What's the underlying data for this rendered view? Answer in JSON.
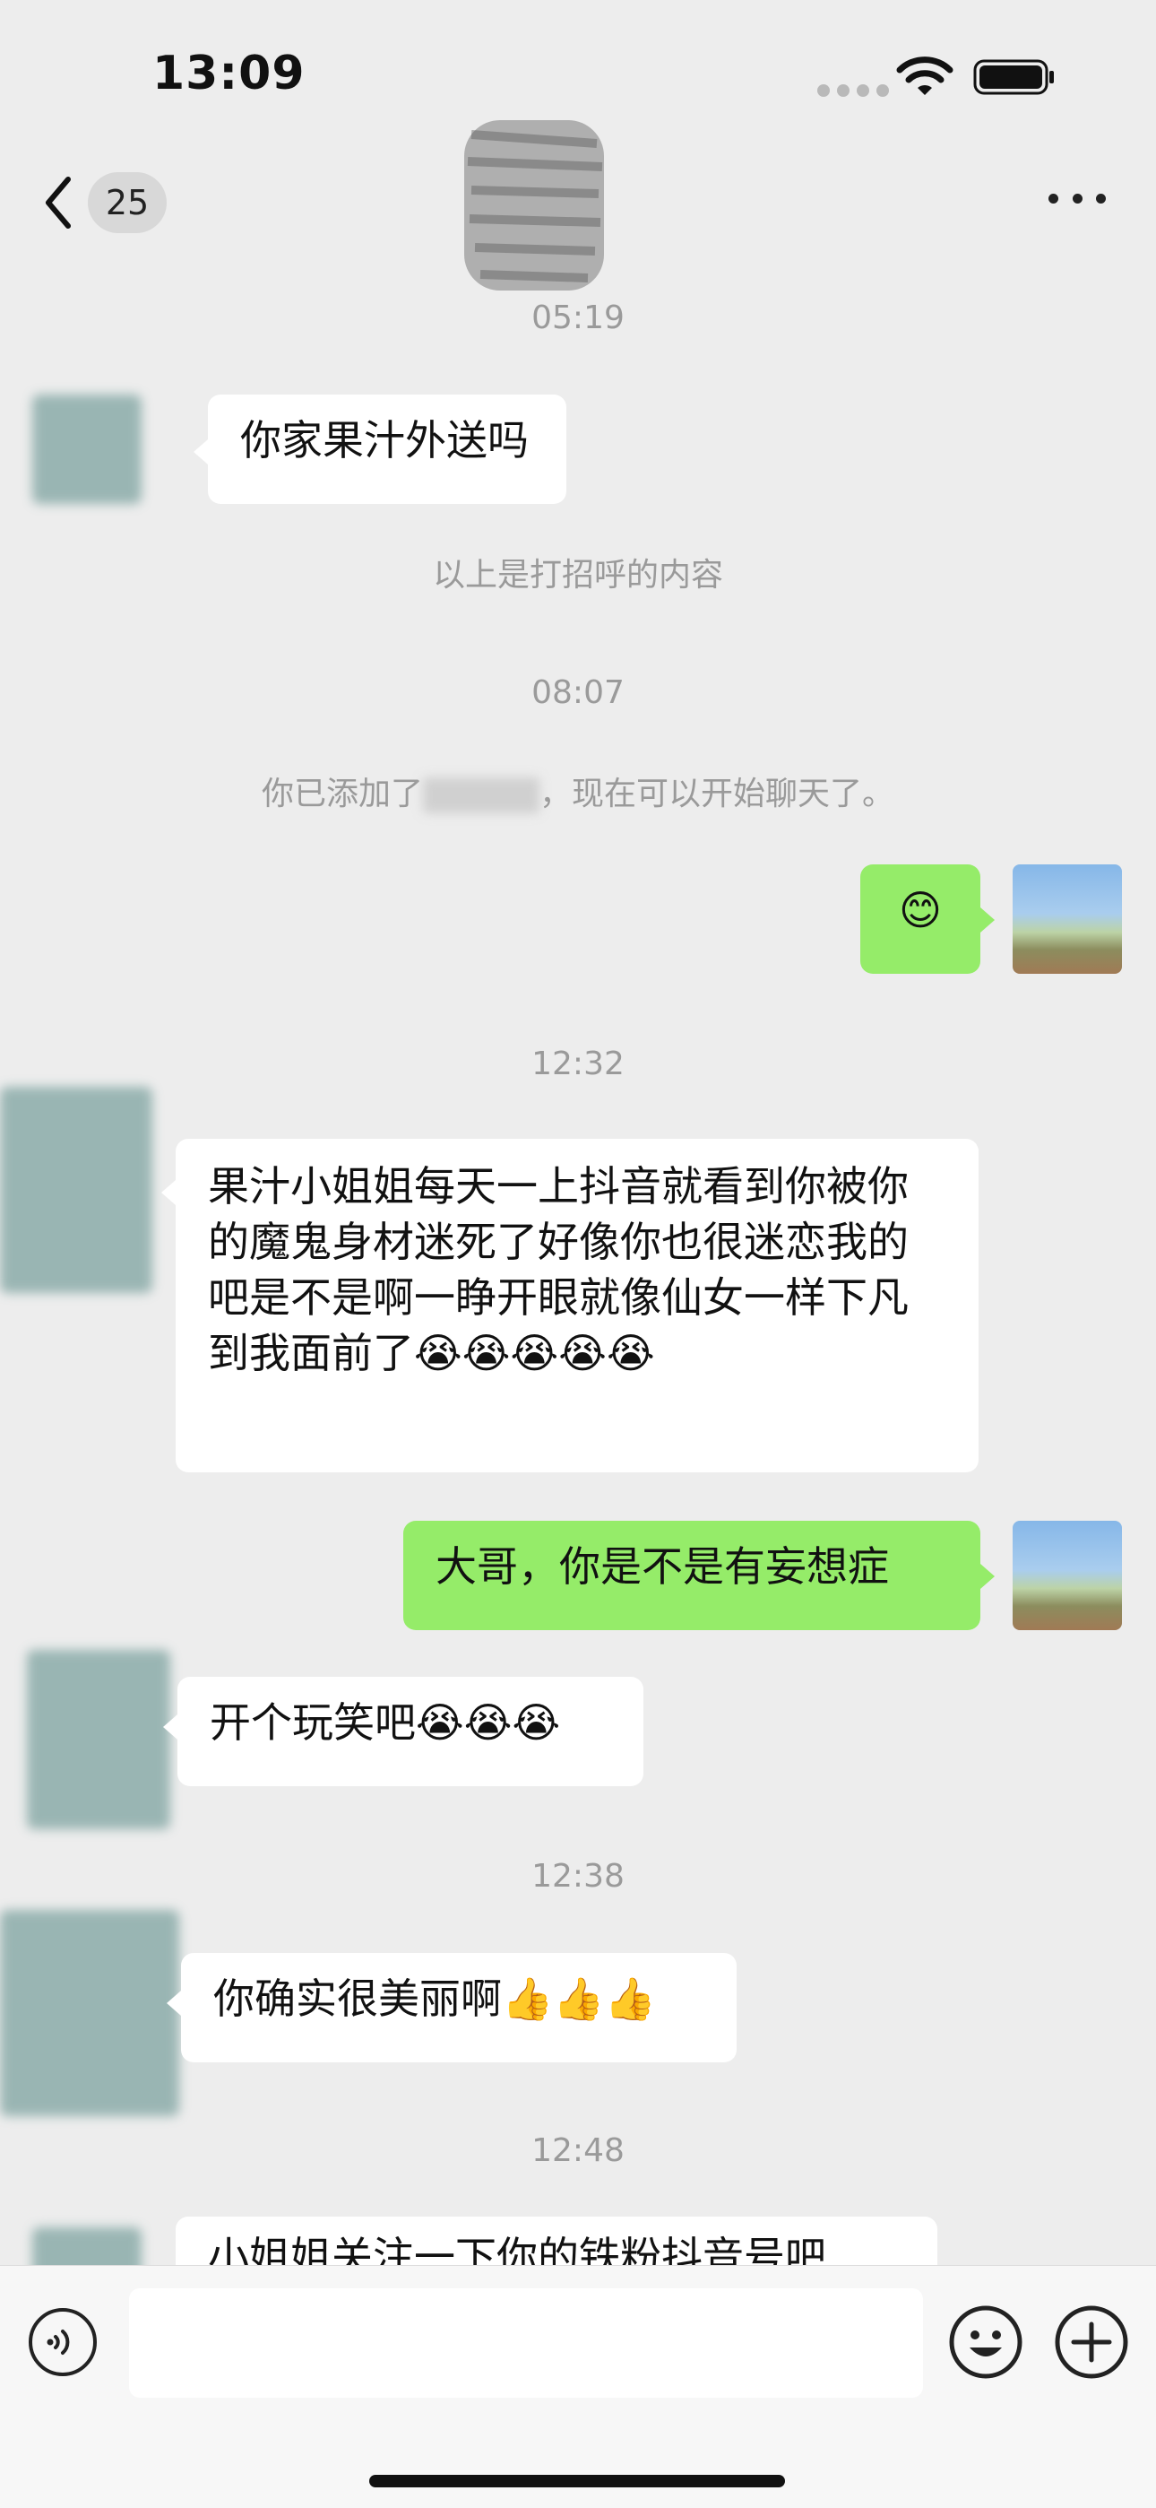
{
  "status_bar": {
    "time": "13:09"
  },
  "nav": {
    "unread_count": "25"
  },
  "messages": {
    "t1": "05:19",
    "m1": "你家果汁外送吗",
    "greeting_note": "以上是打招呼的内容",
    "t2": "08:07",
    "added_note_prefix": "你已添加了",
    "added_note_suffix": "，现在可以开始聊天了。",
    "m2": "😊",
    "t3": "12:32",
    "m3": "果汁小姐姐每天一上抖音就看到你被你的魔鬼身材迷死了好像你也很迷恋我的吧是不是啊一睁开眼就像仙女一样下凡到我面前了😭😭😭😭😭",
    "m4": "大哥，你是不是有妄想症",
    "m5": "开个玩笑吧😭😭😭",
    "t4": "12:38",
    "m6": "你确实很美丽啊👍👍👍",
    "t5": "12:48",
    "m7_partial": "小姐姐关注一下你的铁粉抖音号吧"
  },
  "icons": {
    "back": "chevron-left-icon",
    "more": "more-dots-icon",
    "voice": "voice-icon",
    "emoji": "emoji-icon",
    "plus": "plus-icon"
  },
  "colors": {
    "background": "#ededed",
    "outgoing_bubble": "#95ec69",
    "incoming_bubble": "#ffffff"
  }
}
